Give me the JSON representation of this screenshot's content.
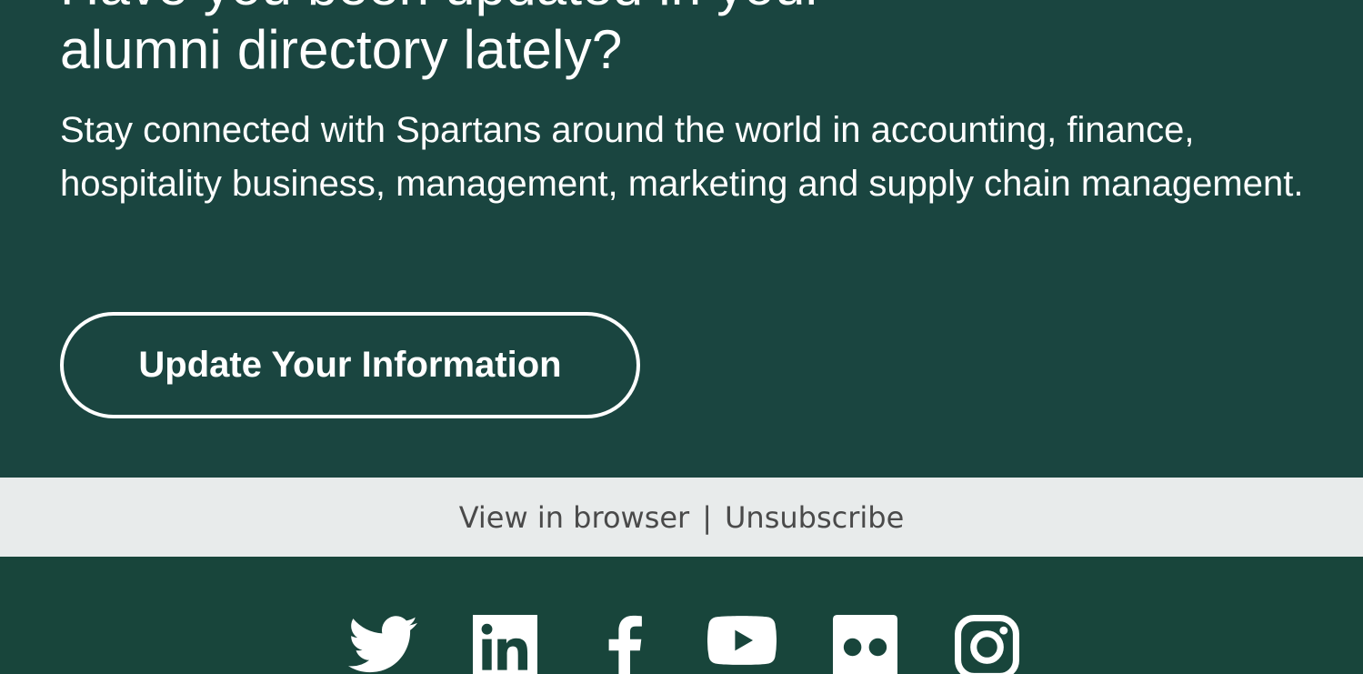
{
  "hero": {
    "headline_line1": "Have you been updated in your",
    "headline_line2": "alumni directory lately?",
    "body": "Stay connected with Spartans around the world in accounting, finance, hospitality business, management, marketing and supply chain management.",
    "cta_label": "Update Your Information"
  },
  "footer": {
    "view_in_browser": "View in browser",
    "separator": "|",
    "unsubscribe": "Unsubscribe"
  },
  "social": {
    "icons": [
      "twitter-icon",
      "linkedin-icon",
      "facebook-icon",
      "youtube-icon",
      "flickr-icon",
      "instagram-icon"
    ]
  },
  "colors": {
    "hero_bg": "#1a4540",
    "footer_bar_bg": "#e8ebeb",
    "footer_text": "#4a4a4a",
    "social_bg": "#18453b",
    "text_white": "#ffffff"
  }
}
